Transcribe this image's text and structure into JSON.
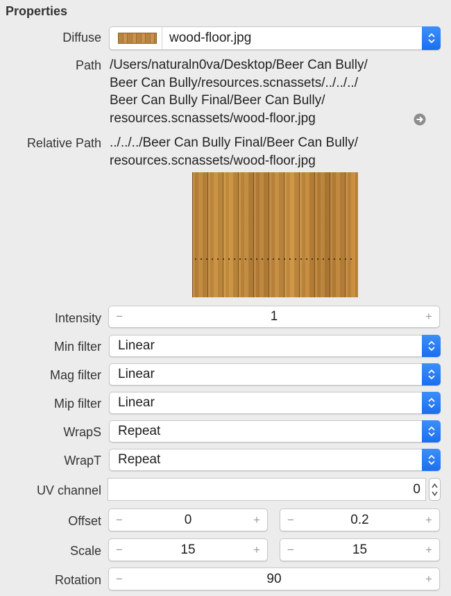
{
  "section": {
    "title": "Properties"
  },
  "diffuse": {
    "label": "Diffuse",
    "value": "wood-floor.jpg"
  },
  "path": {
    "label": "Path",
    "lines": [
      "/Users/naturaln0va/Desktop/Beer Can Bully/",
      "Beer Can Bully/resources.scnassets/../../../",
      "Beer Can Bully Final/Beer Can Bully/",
      "resources.scnassets/wood-floor.jpg"
    ]
  },
  "relative_path": {
    "label": "Relative Path",
    "lines": [
      "../../../Beer Can Bully Final/Beer Can Bully/",
      "resources.scnassets/wood-floor.jpg"
    ]
  },
  "intensity": {
    "label": "Intensity",
    "value": "1"
  },
  "min_filter": {
    "label": "Min filter",
    "value": "Linear"
  },
  "mag_filter": {
    "label": "Mag filter",
    "value": "Linear"
  },
  "mip_filter": {
    "label": "Mip filter",
    "value": "Linear"
  },
  "wrap_s": {
    "label": "WrapS",
    "value": "Repeat"
  },
  "wrap_t": {
    "label": "WrapT",
    "value": "Repeat"
  },
  "uv_channel": {
    "label": "UV channel",
    "value": "0"
  },
  "offset": {
    "label": "Offset",
    "x": "0",
    "y": "0.2"
  },
  "scale": {
    "label": "Scale",
    "x": "15",
    "y": "15"
  },
  "rotation": {
    "label": "Rotation",
    "value": "90"
  },
  "stepper_symbols": {
    "minus": "−",
    "plus": "+"
  },
  "colors": {
    "accent": "#1a6ff0",
    "background": "#ececec",
    "field": "#ffffff"
  },
  "icons": {
    "popup_arrows": "chevron-up-down-icon",
    "reveal": "arrow-circle-right-icon"
  }
}
